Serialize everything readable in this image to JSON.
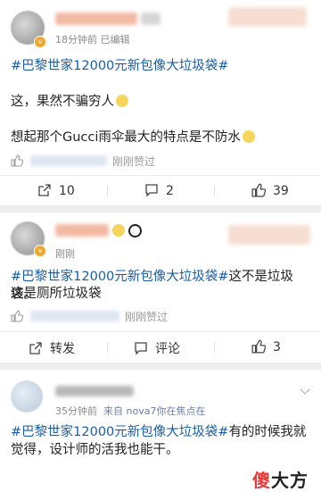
{
  "posts": [
    {
      "meta": "18分钟前  已编辑",
      "topic": "#巴黎世家12000元新包像大垃圾袋#",
      "line1": "这，果然不骗穷人",
      "line2": "想起那个Gucci雨伞最大的特点是不防水",
      "like_suffix": "刚刚赞过",
      "actions": {
        "share_count": "10",
        "comment_count": "2",
        "like_count": "39"
      }
    },
    {
      "meta": "刚刚",
      "topic": "#巴黎世家12000元新包像大垃圾袋#",
      "text_after_topic": "这不是垃圾袋。",
      "line2": "这是厕所垃圾袋",
      "like_suffix": "刚刚赞过",
      "actions": {
        "share_label": "转发",
        "comment_label": "评论",
        "like_count": "3"
      }
    },
    {
      "meta_time": "35分钟前",
      "meta_source": "来自 nova7你在焦点在",
      "topic": "#巴黎世家12000元新包像大垃圾袋#",
      "text_after_topic": "有的时候我就觉得，设计师的活我也能干。"
    }
  ],
  "watermark": {
    "part1": "傻",
    "part2": "大方"
  },
  "colors": {
    "topic": "#1a5da8",
    "watermark_red": "#e53b3b",
    "background": "#ededed"
  }
}
